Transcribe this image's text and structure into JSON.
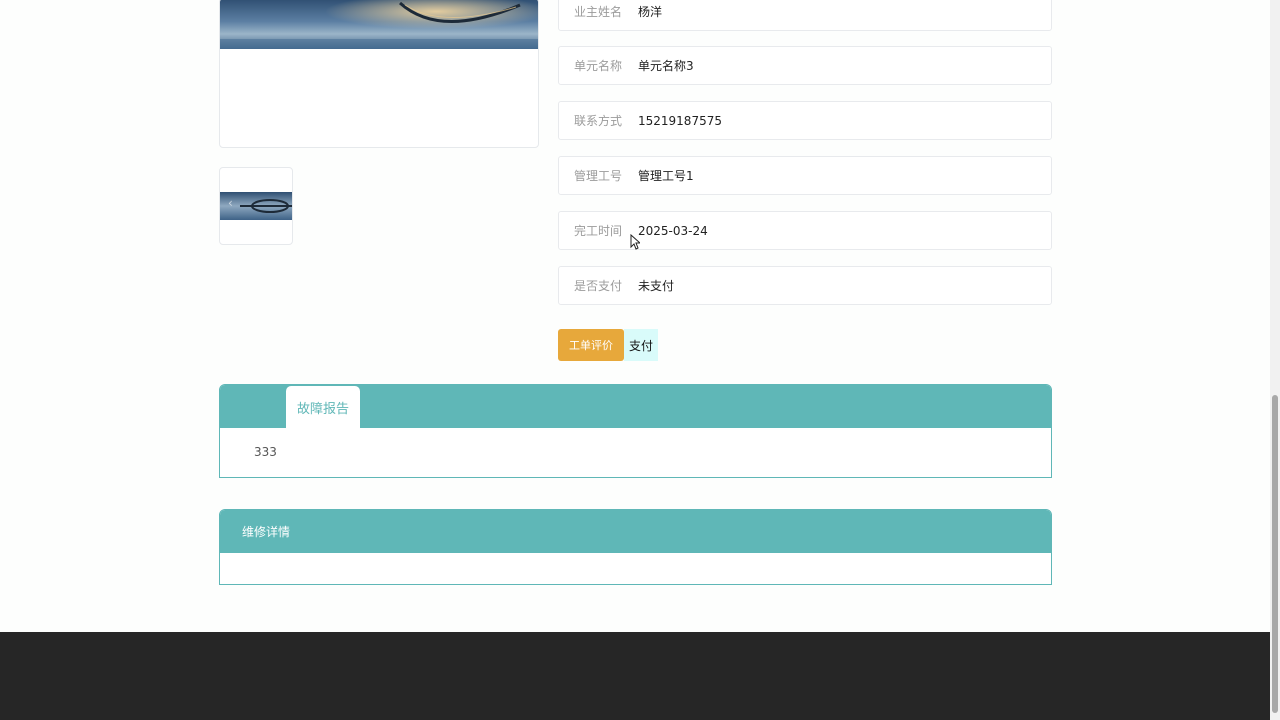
{
  "gallery": {
    "main_image": "bridge-photo",
    "thumbnail": "bridge-photo",
    "thumb_arrow": "‹"
  },
  "details": [
    {
      "label": "业主姓名",
      "value": "杨洋"
    },
    {
      "label": "单元名称",
      "value": "单元名称3"
    },
    {
      "label": "联系方式",
      "value": "15219187575"
    },
    {
      "label": "管理工号",
      "value": "管理工号1"
    },
    {
      "label": "完工时间",
      "value": "2025-03-24"
    },
    {
      "label": "是否支付",
      "value": "未支付"
    }
  ],
  "actions": {
    "review_label": "工单评价",
    "pay_label": "支付"
  },
  "fault_report": {
    "tab_label": "故障报告",
    "content": "333"
  },
  "repair_details": {
    "title": "维修详情"
  },
  "colors": {
    "accent": "#5fb7b7",
    "review_button": "#e7a83b",
    "pay_button": "#d9fbfa",
    "footer": "#262626"
  }
}
